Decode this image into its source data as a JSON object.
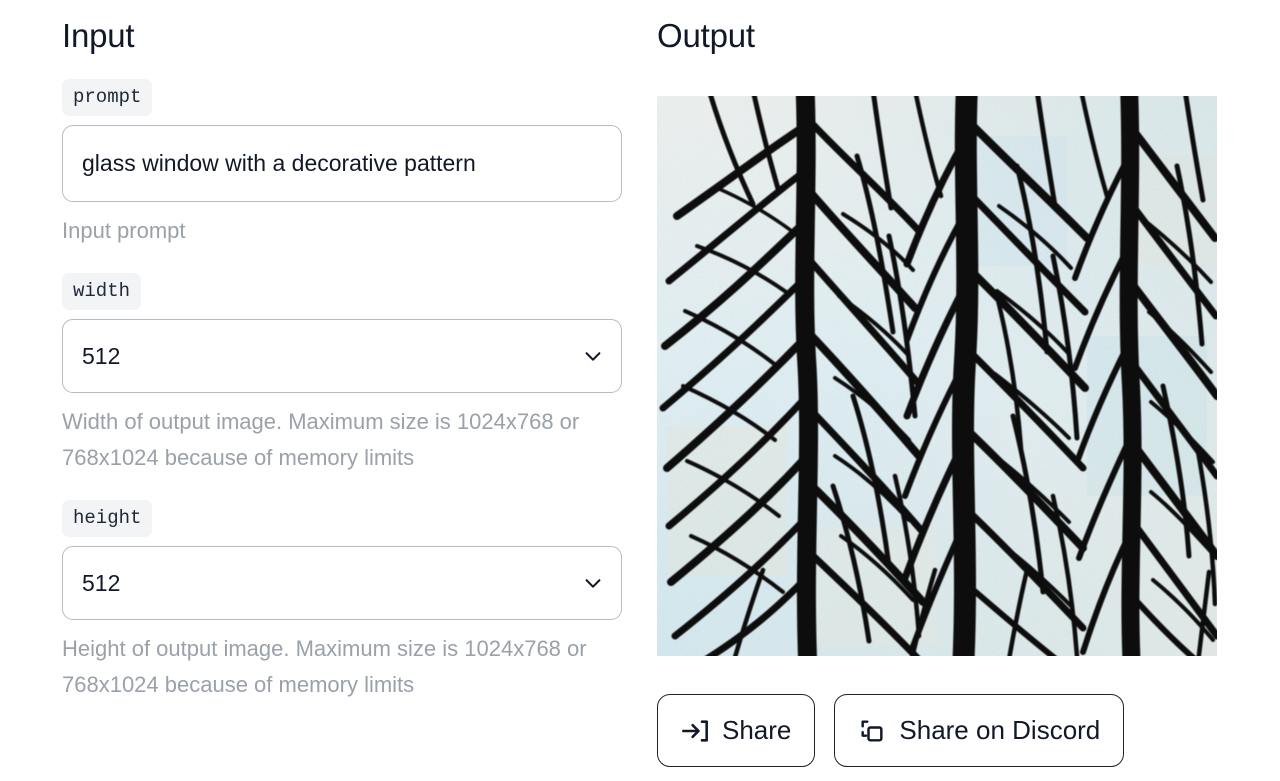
{
  "input": {
    "title": "Input",
    "fields": [
      {
        "chip": "prompt",
        "type": "text",
        "value": "glass window with a decorative pattern",
        "placeholder": "",
        "help": "Input prompt"
      },
      {
        "chip": "width",
        "type": "select",
        "value": "512",
        "help": "Width of output image. Maximum size is 1024x768 or 768x1024 because of memory limits"
      },
      {
        "chip": "height",
        "type": "select",
        "value": "512",
        "help": "Height of output image. Maximum size is 1024x768 or 768x1024 because of memory limits"
      }
    ]
  },
  "output": {
    "title": "Output",
    "image_alt": "stained glass window with decorative leaf vein pattern",
    "buttons": [
      {
        "label": "Share",
        "icon": "share-arrow-icon"
      },
      {
        "label": "Share on Discord",
        "icon": "copy-icon"
      }
    ]
  },
  "icons": {
    "chevron": "chevron-down-icon"
  },
  "colors": {
    "text": "#111827",
    "help_text": "#9aa1aa",
    "chip_bg": "#f3f4f6",
    "border": "#b6bcc4",
    "button_border": "#1f2328",
    "glass_pale": "#dfeef4",
    "glass_cream": "#ece5d2",
    "glass_blue": "#a9d9e8",
    "leading": "#0c0c0c"
  }
}
